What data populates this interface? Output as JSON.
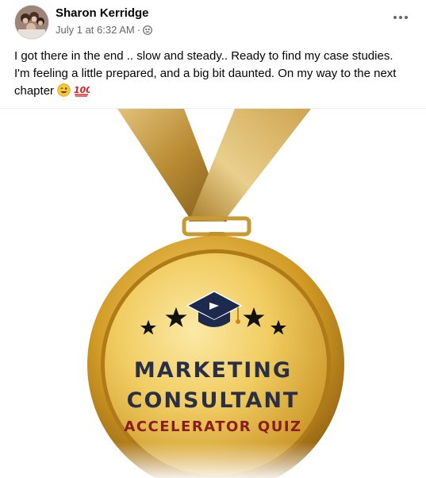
{
  "post": {
    "author": "Sharon Kerridge",
    "date": "July 1 at 6:32 AM",
    "meta_separator": "·",
    "body_text": "I got there in the end .. slow and steady.. Ready to find my case studies. I'm feeling a little prepared, and a big bit daunted. On my way to the next chapter",
    "emojis": [
      "winking-face",
      "hundred-points"
    ]
  },
  "media": {
    "medal_line1": "MARKETING",
    "medal_line2": "CONSULTANT",
    "medal_line3": "ACCELERATOR QUIZ",
    "colors": {
      "gold": "#d4a62a",
      "ribbon": "#c79a3a",
      "text_dark": "#2b2f45",
      "text_red": "#8b1c1c"
    }
  }
}
